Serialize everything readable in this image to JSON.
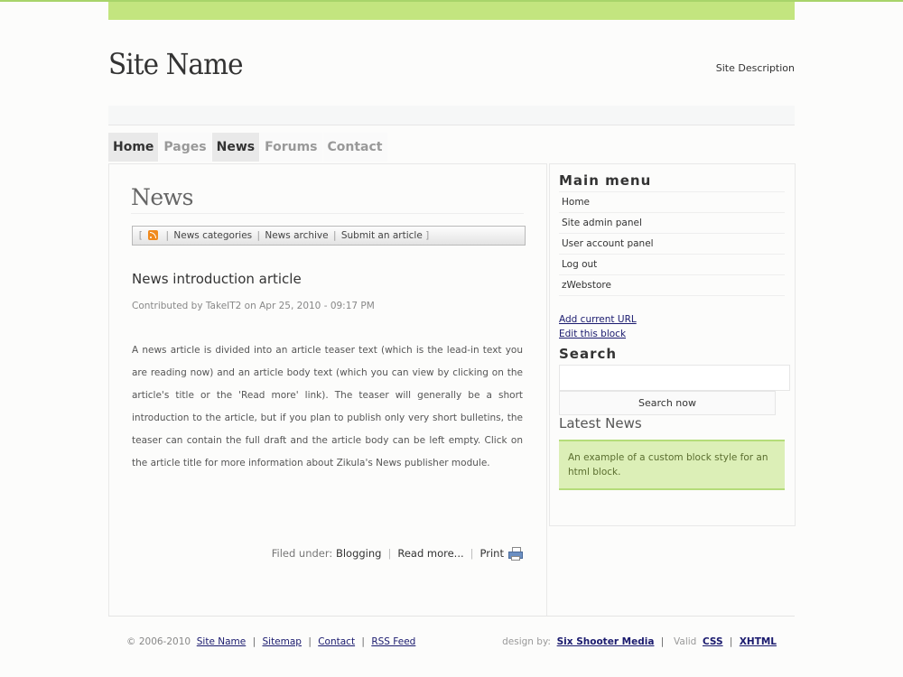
{
  "header": {
    "site_name": "Site Name",
    "site_description": "Site Description"
  },
  "nav": [
    {
      "label": "Home",
      "active": true
    },
    {
      "label": "Pages",
      "active": false
    },
    {
      "label": "News",
      "active": true
    },
    {
      "label": "Forums",
      "active": false
    },
    {
      "label": "Contact",
      "active": false
    }
  ],
  "main": {
    "title": "News",
    "bar": {
      "open": "[",
      "close": "]",
      "sep": "|",
      "links": [
        "News categories",
        "News archive",
        "Submit an article"
      ]
    },
    "article": {
      "title": "News introduction article",
      "meta": "Contributed by TakeIT2 on Apr 25, 2010 - 09:17 PM",
      "body": "A news article is divided into an article teaser text (which is the lead-in text you are reading now) and an article body text (which you can view by clicking on the article's title or the 'Read more' link). The teaser will generally be a short introduction to the article, but if you plan to publish only very short bulletins, the teaser can contain the full draft and the article body can be left empty. Click on the article title for more information about Zikula's News publisher module.",
      "filed_under_label": "Filed under:",
      "category": "Blogging",
      "read_more": "Read more...",
      "print": "Print",
      "sep": "|"
    }
  },
  "sidebar": {
    "main_menu_title": "Main menu",
    "menu_items": [
      "Home",
      "Site admin panel",
      "User account panel",
      "Log out",
      "zWebstore"
    ],
    "add_current_url": "Add current URL",
    "edit_block": "Edit this block",
    "search_title": "Search",
    "search_value": "",
    "search_button": "Search now",
    "latest_news_title": "Latest News",
    "custom_block_text": "An example of a custom block style for an html block."
  },
  "footer": {
    "copyright": "© 2006-2010",
    "links": [
      "Site Name",
      "Sitemap",
      "Contact",
      "RSS Feed"
    ],
    "design_by_label": "design by:",
    "designer": "Six Shooter Media",
    "valid_label": "Valid",
    "css": "CSS",
    "xhtml": "XHTML",
    "sep": "|"
  },
  "colors": {
    "accent_green": "#c3e57f",
    "custom_block_bg": "#dcefb7",
    "link": "#1a1a6e"
  }
}
